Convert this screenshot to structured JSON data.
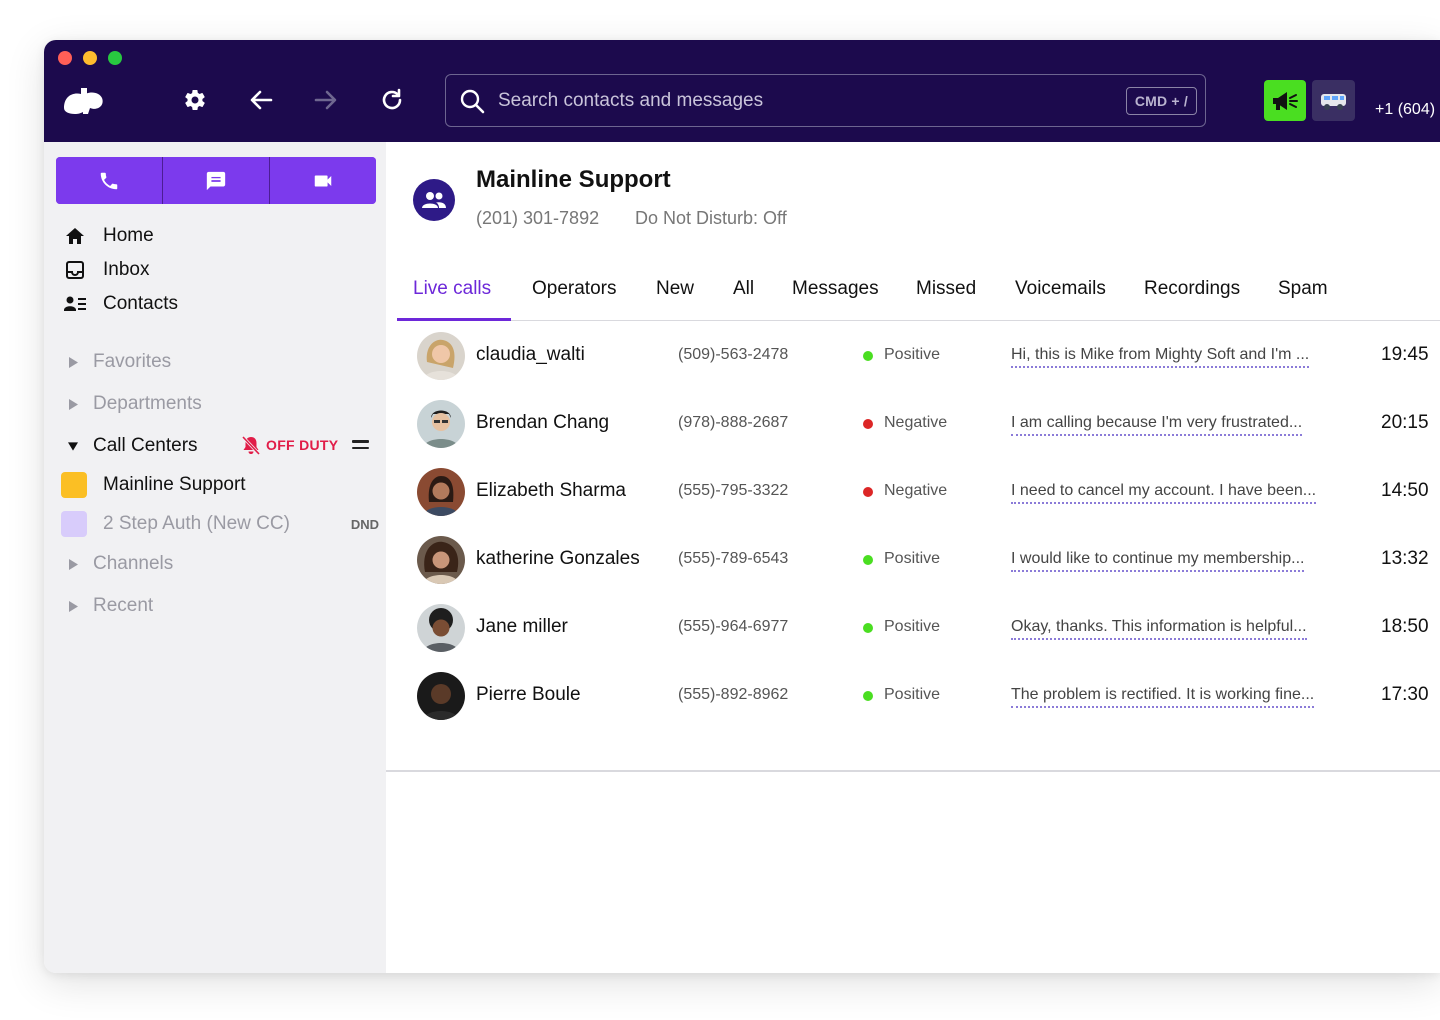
{
  "colors": {
    "titlebar": "#1c0a4d",
    "accent": "#7c3aed",
    "active_tab": "#6d28d9",
    "positive": "#4ade21",
    "negative": "#dc2626",
    "off_duty": "#e11d48",
    "megaphone_bg": "#4ade21"
  },
  "titlebar": {
    "icons": [
      "app-logo-icon",
      "gear-icon",
      "back-arrow-icon",
      "forward-arrow-icon",
      "refresh-icon"
    ],
    "search": {
      "placeholder": "Search contacts and messages",
      "shortcut": "CMD + /"
    },
    "caller_id": "+1 (604)"
  },
  "sidebar": {
    "actions": [
      "phone-icon",
      "message-icon",
      "video-icon"
    ],
    "nav": [
      {
        "label": "Home",
        "icon": "home-icon"
      },
      {
        "label": "Inbox",
        "icon": "inbox-icon"
      },
      {
        "label": "Contacts",
        "icon": "contacts-icon"
      }
    ],
    "sections": {
      "favorites": "Favorites",
      "departments": "Departments",
      "call_centers": "Call Centers",
      "channels": "Channels",
      "recent": "Recent"
    },
    "off_duty_label": "OFF DUTY",
    "call_centers": [
      {
        "label": "Mainline Support",
        "color": "#fbbf24",
        "badge": ""
      },
      {
        "label": "2 Step Auth (New CC)",
        "color": "#d8ccfb",
        "badge": "DND"
      }
    ]
  },
  "header": {
    "name": "Mainline Support",
    "phone": "(201) 301-7892",
    "dnd_status": "Do Not Disturb: Off"
  },
  "tabs": [
    "Live calls",
    "Operators",
    "New",
    "All",
    "Messages",
    "Missed",
    "Voicemails",
    "Recordings",
    "Spam"
  ],
  "active_tab": "Live calls",
  "calls": [
    {
      "name": "claudia_walti",
      "phone": "(509)-563-2478",
      "sentiment": "Positive",
      "snippet": "Hi, this is Mike from Mighty Soft and I'm  ...",
      "time": "19:45"
    },
    {
      "name": "Brendan Chang",
      "phone": "(978)-888-2687",
      "sentiment": "Negative",
      "snippet": "I am calling because I'm very frustrated...",
      "time": "20:15"
    },
    {
      "name": "Elizabeth Sharma",
      "phone": "(555)-795-3322",
      "sentiment": "Negative",
      "snippet": "I need to cancel my account. I have been...",
      "time": "14:50"
    },
    {
      "name": "katherine Gonzales",
      "phone": "(555)-789-6543",
      "sentiment": "Positive",
      "snippet": "I would like to continue my membership...",
      "time": "13:32"
    },
    {
      "name": "Jane miller",
      "phone": "(555)-964-6977",
      "sentiment": "Positive",
      "snippet": "Okay, thanks. This information is helpful...",
      "time": "18:50"
    },
    {
      "name": "Pierre Boule",
      "phone": "(555)-892-8962",
      "sentiment": "Positive",
      "snippet": "The problem is rectified. It is working fine...",
      "time": "17:30"
    }
  ]
}
